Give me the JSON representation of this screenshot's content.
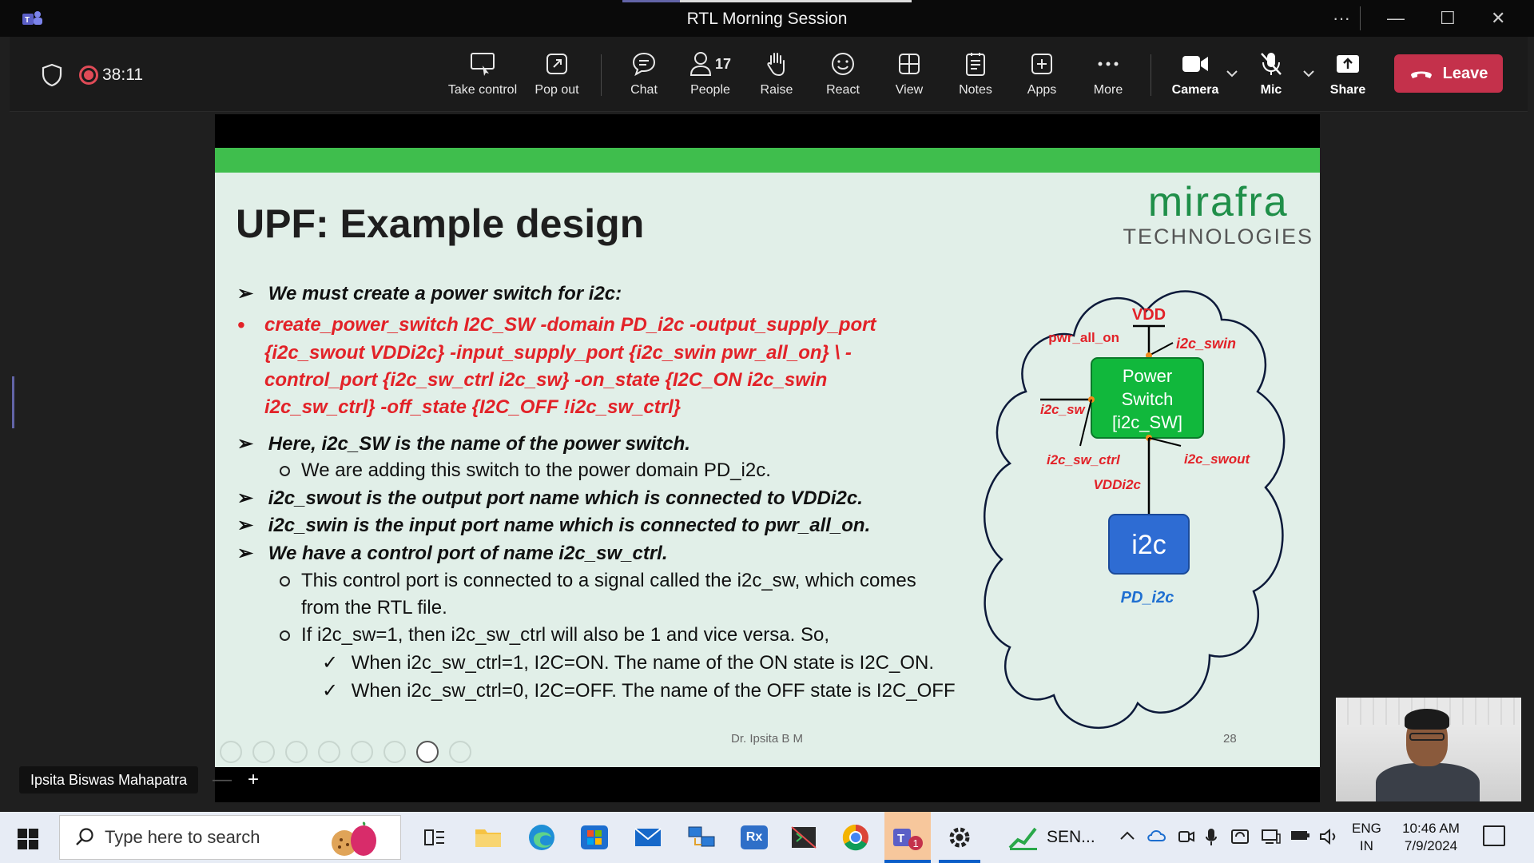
{
  "window": {
    "title": "RTL Morning Session",
    "minimize_glyph": "—",
    "maximize_glyph": "☐",
    "close_glyph": "✕",
    "more_glyph": "···",
    "share_progress": 0.2
  },
  "toolbar": {
    "timer": "38:11",
    "buttons": {
      "take_control": "Take control",
      "pop_out": "Pop out",
      "chat": "Chat",
      "people": "People",
      "people_count": "17",
      "raise": "Raise",
      "react": "React",
      "view": "View",
      "notes": "Notes",
      "apps": "Apps",
      "more": "More",
      "camera": "Camera",
      "mic": "Mic",
      "share": "Share"
    },
    "leave": "Leave",
    "colors": {
      "leave": "#c4314b",
      "record": "#e04b57"
    }
  },
  "slide": {
    "title": "UPF: Example design",
    "brand": {
      "name": "mirafra",
      "tagline": "TECHNOLOGIES",
      "color": "#1f8f49"
    },
    "lines": {
      "l1": "We must create a power switch for i2c:",
      "cmd1": "create_power_switch  I2C_SW  -domain   PD_i2c  -output_supply_port",
      "cmd2": "{i2c_swout  VDDi2c}  -input_supply_port  {i2c_swin  pwr_all_on} \\ -",
      "cmd3": "control_port  {i2c_sw_ctrl  i2c_sw}  -on_state {I2C_ON i2c_swin",
      "cmd4": "i2c_sw_ctrl} -off_state {I2C_OFF !i2c_sw_ctrl}",
      "l2": "Here, i2c_SW is the name of the power switch.",
      "s1": "We are adding this switch to the power domain PD_i2c.",
      "l3": "i2c_swout  is the output port name which is connected to VDDi2c.",
      "l4": "i2c_swin is the input port name which is connected to pwr_all_on.",
      "l5": "We have a control port of name i2c_sw_ctrl.",
      "s2a": "This control port is connected to a signal called the i2c_sw, which comes",
      "s2b": "from the RTL file.",
      "s3": "If i2c_sw=1, then i2c_sw_ctrl will also be 1 and vice versa. So,",
      "c1": "When i2c_sw_ctrl=1, I2C=ON. The name of the ON state is I2C_ON.",
      "c2": "When i2c_sw_ctrl=0, I2C=OFF. The name of the OFF state is I2C_OFF"
    },
    "bullets": {
      "arrow": "➢",
      "dot": "•",
      "check": "✓"
    },
    "diagram": {
      "vdd": "VDD",
      "pwr_all_on": "pwr_all_on",
      "i2c_swin": "i2c_swin",
      "switch_l1": "Power",
      "switch_l2": "Switch",
      "switch_l3": "[i2c_SW]",
      "i2c_sw": "i2c_sw",
      "i2c_sw_ctrl": "i2c_sw_ctrl",
      "i2c_swout": "i2c_swout",
      "vddi2c": "VDDi2c",
      "block": "i2c",
      "domain": "PD_i2c"
    },
    "footer": {
      "author": "Dr. Ipsita B M",
      "page": "28"
    }
  },
  "participant": {
    "name": "Ipsita Biswas Mahapatra"
  },
  "zoom": {
    "minus": "—",
    "plus": "+"
  },
  "taskbar": {
    "search_placeholder": "Type here to search",
    "sen_label": "SEN...",
    "lang_line1": "ENG",
    "lang_line2": "IN",
    "time": "10:46 AM",
    "date": "7/9/2024"
  }
}
